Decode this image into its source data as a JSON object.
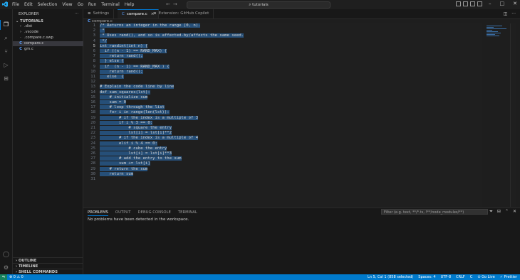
{
  "titlebar": {
    "menu": [
      "File",
      "Edit",
      "Selection",
      "View",
      "Go",
      "Run",
      "Terminal",
      "Help"
    ],
    "search_text": "tutorials"
  },
  "sidebar": {
    "title": "EXPLORER",
    "more": "···",
    "folder": "TUTORIALS",
    "items": [
      {
        "icon": "›",
        "label": ".dist",
        "selected": false,
        "type": "folder"
      },
      {
        "icon": "›",
        "label": ".vscode",
        "selected": false,
        "type": "folder"
      },
      {
        "icon": "·",
        "label": ".compare.c.swp",
        "selected": false,
        "type": "file"
      },
      {
        "icon": "C",
        "label": "compare.c",
        "selected": true,
        "type": "c"
      },
      {
        "icon": "C",
        "label": "gm.c",
        "selected": false,
        "type": "c"
      }
    ],
    "bottom_sections": [
      "OUTLINE",
      "TIMELINE",
      "SHELL COMMANDS"
    ]
  },
  "tabs": [
    {
      "label": "Settings",
      "active": false,
      "close": ""
    },
    {
      "label": "compare.c",
      "active": true,
      "close": "×"
    },
    {
      "label": "Extension: GitHub Copilot",
      "active": false,
      "close": ""
    }
  ],
  "breadcrumb": {
    "file": "compare.c"
  },
  "editor": {
    "current_line": 5,
    "lines": [
      {
        "n": 1,
        "pre": "",
        "sel": "/* Returns an integer in the range [0, n)."
      },
      {
        "n": 2,
        "pre": "",
        "sel": " *"
      },
      {
        "n": 3,
        "pre": "",
        "sel": " * Uses rand(), and so is affected-by/affects the same seed."
      },
      {
        "n": 4,
        "pre": "",
        "sel": " */"
      },
      {
        "n": 5,
        "pre": "",
        "sel": "int randint(int n) {"
      },
      {
        "n": 6,
        "pre": "",
        "sel": "  if ((n - 1) == RAND_MAX) {"
      },
      {
        "n": 7,
        "pre": "",
        "sel": "    return rand();"
      },
      {
        "n": 8,
        "pre": "",
        "sel": "  } else {"
      },
      {
        "n": 9,
        "pre": "",
        "sel": "  if  (n - 1) == RAND_MAX ) {"
      },
      {
        "n": 10,
        "pre": "",
        "sel": "    return rand();"
      },
      {
        "n": 11,
        "pre": "",
        "sel": "   else  {"
      },
      {
        "n": 12,
        "pre": "",
        "sel": ""
      },
      {
        "n": 13,
        "pre": "",
        "sel": "# Explain the code line by line"
      },
      {
        "n": 14,
        "pre": "",
        "sel": "def sum_squares(lst):"
      },
      {
        "n": 15,
        "pre": "",
        "sel": "    # initialize sum"
      },
      {
        "n": 16,
        "pre": "",
        "sel": "    sum = 0"
      },
      {
        "n": 17,
        "pre": "",
        "sel": "    # loop through the list"
      },
      {
        "n": 18,
        "pre": "",
        "sel": "    for i in range(len(lst)):"
      },
      {
        "n": 19,
        "pre": "",
        "sel": "        # if the index is a multiple of 3"
      },
      {
        "n": 20,
        "pre": "",
        "sel": "        if i % 3 == 0:"
      },
      {
        "n": 21,
        "pre": "",
        "sel": "            # square the entry"
      },
      {
        "n": 22,
        "pre": "",
        "sel": "            lst[i] = lst[i]**2"
      },
      {
        "n": 23,
        "pre": "",
        "sel": "        # if the index is a multiple of 4"
      },
      {
        "n": 24,
        "pre": "",
        "sel": "        elif i % 4 == 0:"
      },
      {
        "n": 25,
        "pre": "",
        "sel": "            # cube the entry"
      },
      {
        "n": 26,
        "pre": "",
        "sel": "            lst[i] = lst[i]**3"
      },
      {
        "n": 27,
        "pre": "",
        "sel": "        # add the entry to the sum"
      },
      {
        "n": 28,
        "pre": "",
        "sel": "        sum += lst[i]"
      },
      {
        "n": 29,
        "pre": "",
        "sel": "    # return the sum"
      },
      {
        "n": 30,
        "pre": "",
        "sel": "    return sum"
      },
      {
        "n": 31,
        "pre": "",
        "sel": ""
      }
    ]
  },
  "panel": {
    "tabs": [
      {
        "label": "PROBLEMS",
        "active": true
      },
      {
        "label": "OUTPUT",
        "active": false
      },
      {
        "label": "DEBUG CONSOLE",
        "active": false
      },
      {
        "label": "TERMINAL",
        "active": false
      }
    ],
    "filter_placeholder": "Filter (e.g. text, **/*.ts, !**/node_modules/**)",
    "message": "No problems have been detected in the workspace."
  },
  "statusbar": {
    "problems": "⊗ 0  ⚠ 0",
    "right": [
      "Ln 5, Col 1 (858 selected)",
      "Spaces: 4",
      "UTF-8",
      "CRLF",
      "C",
      "⊙ Go Live",
      "✓ Prettier"
    ]
  },
  "colors": {
    "accent": "#007acc",
    "selection": "#264f78"
  }
}
